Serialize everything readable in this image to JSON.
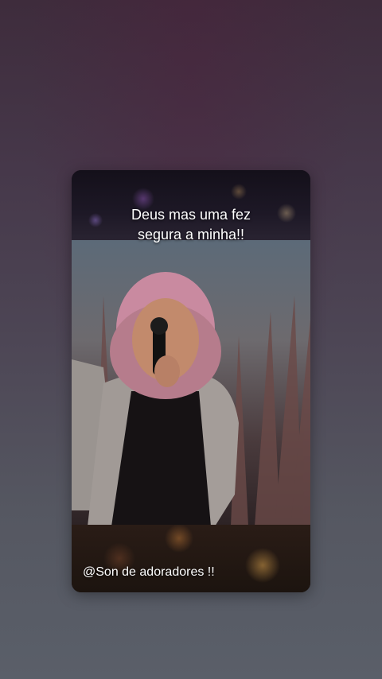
{
  "story": {
    "caption_line1": "Deus mas uma fez",
    "caption_line2": "segura a minha!!",
    "credit": "@Son de adoradores !!"
  },
  "colors": {
    "background_top": "#3e2c3c",
    "background_bottom": "#5a5f69",
    "caption_text": "#ffffff"
  }
}
